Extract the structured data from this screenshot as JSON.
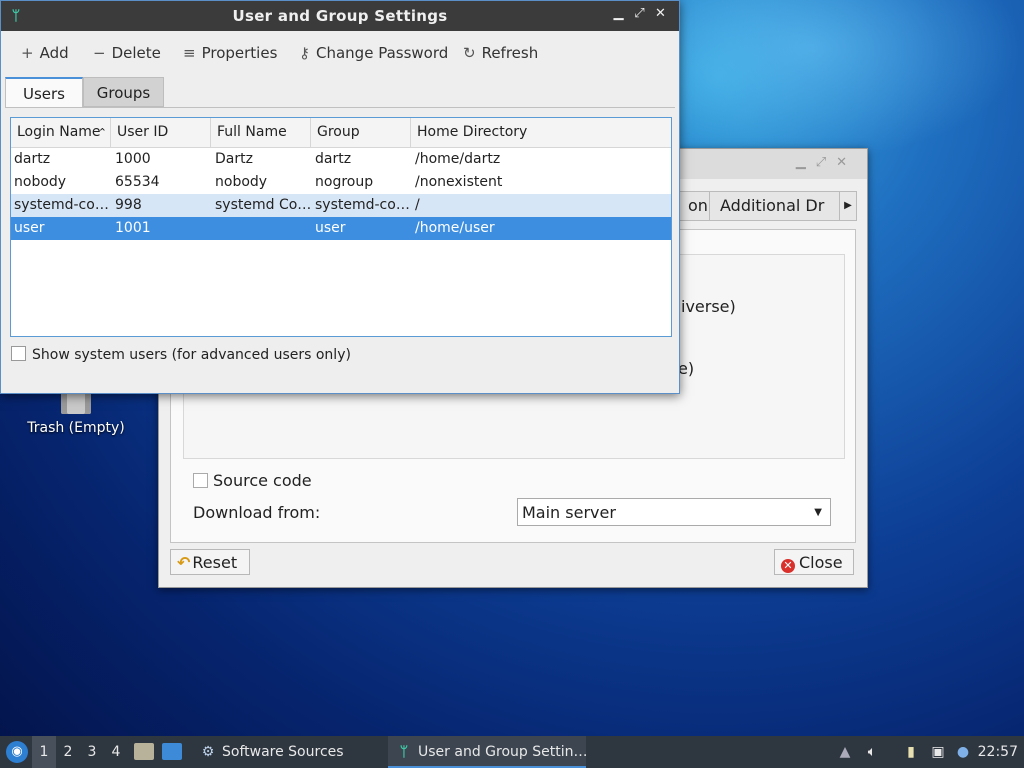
{
  "desktop": {
    "trash_label": "Trash (Empty)"
  },
  "back_window": {
    "tab_fragment_1": "on",
    "tab_fragment_2": "Additional Dr",
    "frag_paren": ")",
    "frag_iverse": "iverse)",
    "frag_e": "e)",
    "source_code_label": "Source code",
    "download_from_label": "Download from:",
    "download_from_value": "Main server",
    "reset_label": "Reset",
    "close_label": "Close"
  },
  "window": {
    "title": "User and Group Settings",
    "controls": {
      "minimize": "▁",
      "maximize": "⤢",
      "close": "✕"
    }
  },
  "toolbar": {
    "add": "Add",
    "delete": "Delete",
    "properties": "Properties",
    "change_password": "Change Password",
    "refresh": "Refresh"
  },
  "tabs": {
    "users": "Users",
    "groups": "Groups"
  },
  "table": {
    "headers": [
      "Login Name",
      "User ID",
      "Full Name",
      "Group",
      "Home Directory"
    ],
    "rows": [
      [
        "dartz",
        "1000",
        "Dartz",
        "dartz",
        "/home/dartz"
      ],
      [
        "nobody",
        "65534",
        "nobody",
        "nogroup",
        "/nonexistent"
      ],
      [
        "systemd-co…",
        "998",
        "systemd Co…",
        "systemd-co…",
        "/"
      ],
      [
        "user",
        "1001",
        "",
        "user",
        "/home/user"
      ]
    ]
  },
  "show_system_users": {
    "label": "Show system users (for advanced users only)",
    "checked": false
  },
  "taskbar": {
    "workspaces": [
      "1",
      "2",
      "3",
      "4"
    ],
    "tasks": [
      "Software Sources",
      "User and Group Settin…"
    ],
    "clock": "22:57"
  }
}
